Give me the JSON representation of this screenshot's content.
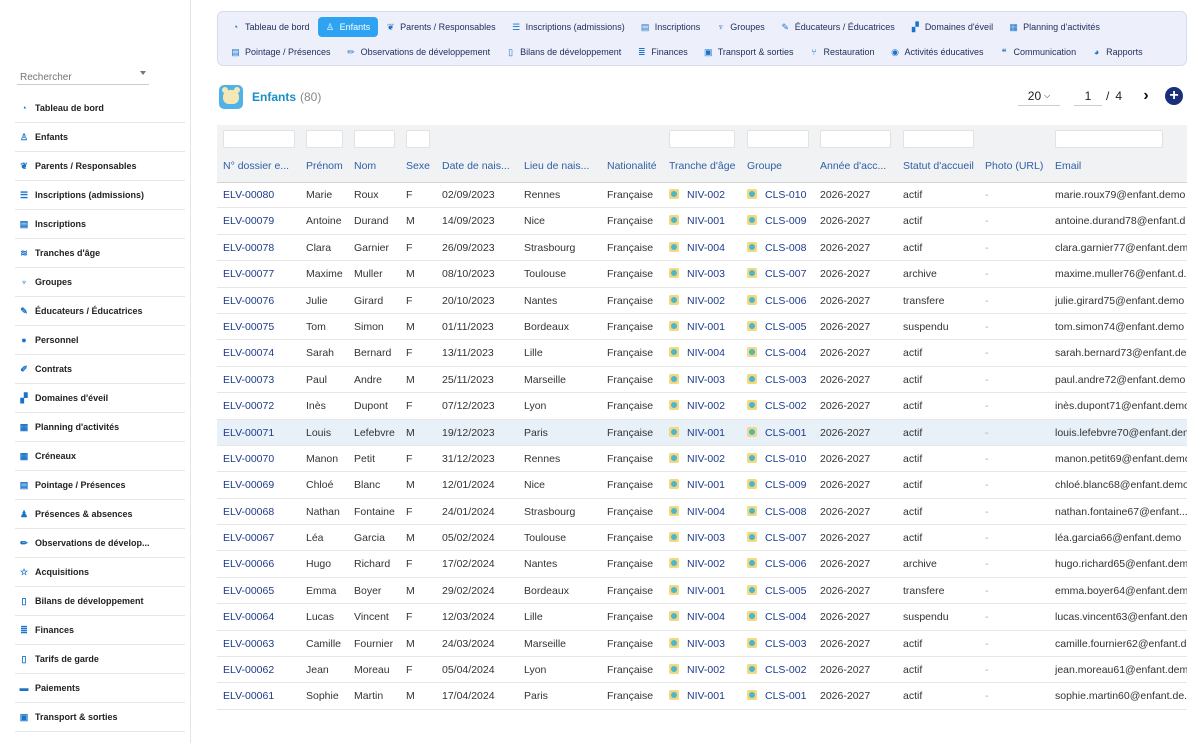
{
  "sidebar": {
    "search_placeholder": "Rechercher",
    "items": [
      {
        "label": "Tableau de bord",
        "icon": "dashboard-icon"
      },
      {
        "label": "Enfants",
        "icon": "child-icon"
      },
      {
        "label": "Parents / Responsables",
        "icon": "users-icon"
      },
      {
        "label": "Inscriptions (admissions)",
        "icon": "list-icon"
      },
      {
        "label": "Inscriptions",
        "icon": "clipboard-icon"
      },
      {
        "label": "Tranches d'âge",
        "icon": "layers-icon"
      },
      {
        "label": "Groupes",
        "icon": "group-icon"
      },
      {
        "label": "Éducateurs / Éducatrices",
        "icon": "educator-icon"
      },
      {
        "label": "Personnel",
        "icon": "person-icon"
      },
      {
        "label": "Contrats",
        "icon": "contract-icon"
      },
      {
        "label": "Domaines d'éveil",
        "icon": "domain-icon"
      },
      {
        "label": "Planning d'activités",
        "icon": "calendar-icon"
      },
      {
        "label": "Créneaux",
        "icon": "calendar-icon"
      },
      {
        "label": "Pointage / Présences",
        "icon": "clipboard-icon"
      },
      {
        "label": "Présences & absences",
        "icon": "user-check-icon"
      },
      {
        "label": "Observations de dévelop...",
        "icon": "pen-icon"
      },
      {
        "label": "Acquisitions",
        "icon": "star-icon"
      },
      {
        "label": "Bilans de développement",
        "icon": "document-icon"
      },
      {
        "label": "Finances",
        "icon": "finance-icon"
      },
      {
        "label": "Tarifs de garde",
        "icon": "document-icon"
      },
      {
        "label": "Paiements",
        "icon": "card-icon"
      },
      {
        "label": "Transport & sorties",
        "icon": "bus-icon"
      }
    ]
  },
  "topnav": {
    "row1": [
      {
        "label": "Tableau de bord",
        "icon": "dashboard-icon",
        "active": false
      },
      {
        "label": "Enfants",
        "icon": "child-icon",
        "active": true
      },
      {
        "label": "Parents / Responsables",
        "icon": "users-icon",
        "active": false
      },
      {
        "label": "Inscriptions (admissions)",
        "icon": "list-icon",
        "active": false
      },
      {
        "label": "Inscriptions",
        "icon": "clipboard-icon",
        "active": false
      },
      {
        "label": "Groupes",
        "icon": "group-icon",
        "active": false
      },
      {
        "label": "Éducateurs / Éducatrices",
        "icon": "educator-icon",
        "active": false
      },
      {
        "label": "Domaines d'éveil",
        "icon": "domain-icon",
        "active": false
      },
      {
        "label": "Planning d'activités",
        "icon": "calendar-icon",
        "active": false
      }
    ],
    "row2": [
      {
        "label": "Pointage / Présences",
        "icon": "clipboard-icon",
        "active": false
      },
      {
        "label": "Observations de développement",
        "icon": "pen-icon",
        "active": false
      },
      {
        "label": "Bilans de développement",
        "icon": "document-icon",
        "active": false
      },
      {
        "label": "Finances",
        "icon": "finance-icon",
        "active": false
      },
      {
        "label": "Transport & sorties",
        "icon": "bus-icon",
        "active": false
      },
      {
        "label": "Restauration",
        "icon": "fork-knife-icon",
        "active": false
      },
      {
        "label": "Activités éducatives",
        "icon": "palette-icon",
        "active": false
      },
      {
        "label": "Communication",
        "icon": "chat-icon",
        "active": false
      },
      {
        "label": "Rapports",
        "icon": "chart-icon",
        "active": false
      }
    ]
  },
  "header": {
    "title": "Enfants",
    "count": "(80)"
  },
  "pager": {
    "per_page": "20",
    "page": "1",
    "sep": "/",
    "total": "4"
  },
  "colors": {
    "accent": "#2ea3f2",
    "link": "#1e3b8a",
    "header_text": "#2e5fa5"
  },
  "table": {
    "columns": [
      "N° dossier e...",
      "Prénom",
      "Nom",
      "Sexe",
      "Date de nais...",
      "Lieu de nais...",
      "Nationalité",
      "Tranche d'âge",
      "Groupe",
      "Année d'acc...",
      "Statut d'accueil",
      "Photo (URL)",
      "Email"
    ],
    "rows": [
      [
        "ELV-00080",
        "Marie",
        "Roux",
        "F",
        "02/09/2023",
        "Rennes",
        "Française",
        "NIV-002",
        "CLS-010",
        "2026-2027",
        "actif",
        "-",
        "marie.roux79@enfant.demo"
      ],
      [
        "ELV-00079",
        "Antoine",
        "Durand",
        "M",
        "14/09/2023",
        "Nice",
        "Française",
        "NIV-001",
        "CLS-009",
        "2026-2027",
        "actif",
        "-",
        "antoine.durand78@enfant.d"
      ],
      [
        "ELV-00078",
        "Clara",
        "Garnier",
        "F",
        "26/09/2023",
        "Strasbourg",
        "Française",
        "NIV-004",
        "CLS-008",
        "2026-2027",
        "actif",
        "-",
        "clara.garnier77@enfant.dem"
      ],
      [
        "ELV-00077",
        "Maxime",
        "Muller",
        "M",
        "08/10/2023",
        "Toulouse",
        "Française",
        "NIV-003",
        "CLS-007",
        "2026-2027",
        "archive",
        "-",
        "maxime.muller76@enfant.d..."
      ],
      [
        "ELV-00076",
        "Julie",
        "Girard",
        "F",
        "20/10/2023",
        "Nantes",
        "Française",
        "NIV-002",
        "CLS-006",
        "2026-2027",
        "transfere",
        "-",
        "julie.girard75@enfant.demo"
      ],
      [
        "ELV-00075",
        "Tom",
        "Simon",
        "M",
        "01/11/2023",
        "Bordeaux",
        "Française",
        "NIV-001",
        "CLS-005",
        "2026-2027",
        "suspendu",
        "-",
        "tom.simon74@enfant.demo"
      ],
      [
        "ELV-00074",
        "Sarah",
        "Bernard",
        "F",
        "13/11/2023",
        "Lille",
        "Française",
        "NIV-004",
        "CLS-004",
        "2026-2027",
        "actif",
        "-",
        "sarah.bernard73@enfant.de"
      ],
      [
        "ELV-00073",
        "Paul",
        "Andre",
        "M",
        "25/11/2023",
        "Marseille",
        "Française",
        "NIV-003",
        "CLS-003",
        "2026-2027",
        "actif",
        "-",
        "paul.andre72@enfant.demo"
      ],
      [
        "ELV-00072",
        "Inès",
        "Dupont",
        "F",
        "07/12/2023",
        "Lyon",
        "Française",
        "NIV-002",
        "CLS-002",
        "2026-2027",
        "actif",
        "-",
        "inès.dupont71@enfant.demo"
      ],
      [
        "ELV-00071",
        "Louis",
        "Lefebvre",
        "M",
        "19/12/2023",
        "Paris",
        "Française",
        "NIV-001",
        "CLS-001",
        "2026-2027",
        "actif",
        "-",
        "louis.lefebvre70@enfant.den"
      ],
      [
        "ELV-00070",
        "Manon",
        "Petit",
        "F",
        "31/12/2023",
        "Rennes",
        "Française",
        "NIV-002",
        "CLS-010",
        "2026-2027",
        "actif",
        "-",
        "manon.petit69@enfant.demo"
      ],
      [
        "ELV-00069",
        "Chloé",
        "Blanc",
        "M",
        "12/01/2024",
        "Nice",
        "Française",
        "NIV-001",
        "CLS-009",
        "2026-2027",
        "actif",
        "-",
        "chloé.blanc68@enfant.demo"
      ],
      [
        "ELV-00068",
        "Nathan",
        "Fontaine",
        "F",
        "24/01/2024",
        "Strasbourg",
        "Française",
        "NIV-004",
        "CLS-008",
        "2026-2027",
        "actif",
        "-",
        "nathan.fontaine67@enfant...."
      ],
      [
        "ELV-00067",
        "Léa",
        "Garcia",
        "M",
        "05/02/2024",
        "Toulouse",
        "Française",
        "NIV-003",
        "CLS-007",
        "2026-2027",
        "actif",
        "-",
        "léa.garcia66@enfant.demo"
      ],
      [
        "ELV-00066",
        "Hugo",
        "Richard",
        "F",
        "17/02/2024",
        "Nantes",
        "Française",
        "NIV-002",
        "CLS-006",
        "2026-2027",
        "archive",
        "-",
        "hugo.richard65@enfant.demo"
      ],
      [
        "ELV-00065",
        "Emma",
        "Boyer",
        "M",
        "29/02/2024",
        "Bordeaux",
        "Française",
        "NIV-001",
        "CLS-005",
        "2026-2027",
        "transfere",
        "-",
        "emma.boyer64@enfant.demo"
      ],
      [
        "ELV-00064",
        "Lucas",
        "Vincent",
        "F",
        "12/03/2024",
        "Lille",
        "Française",
        "NIV-004",
        "CLS-004",
        "2026-2027",
        "suspendu",
        "-",
        "lucas.vincent63@enfant.dem"
      ],
      [
        "ELV-00063",
        "Camille",
        "Fournier",
        "M",
        "24/03/2024",
        "Marseille",
        "Française",
        "NIV-003",
        "CLS-003",
        "2026-2027",
        "actif",
        "-",
        "camille.fournier62@enfant.d"
      ],
      [
        "ELV-00062",
        "Jean",
        "Moreau",
        "F",
        "05/04/2024",
        "Lyon",
        "Française",
        "NIV-002",
        "CLS-002",
        "2026-2027",
        "actif",
        "-",
        "jean.moreau61@enfant.dem"
      ],
      [
        "ELV-00061",
        "Sophie",
        "Martin",
        "M",
        "17/04/2024",
        "Paris",
        "Française",
        "NIV-001",
        "CLS-001",
        "2026-2027",
        "actif",
        "-",
        "sophie.martin60@enfant.de..."
      ]
    ]
  }
}
